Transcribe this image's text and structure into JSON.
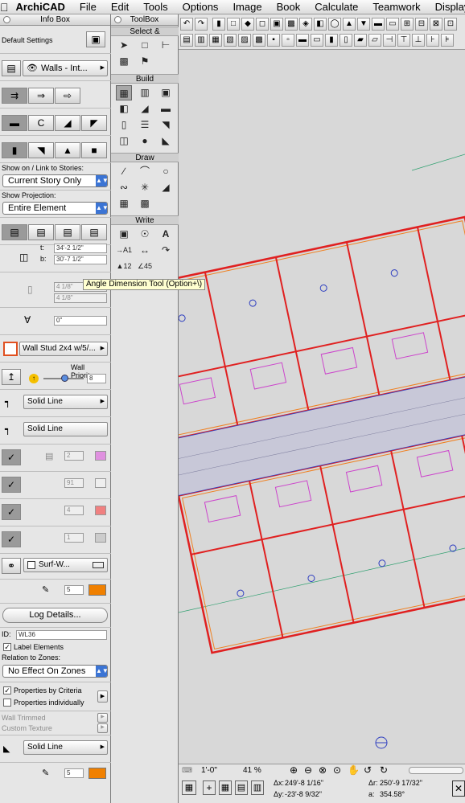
{
  "menubar": {
    "items": [
      "ArchiCAD",
      "File",
      "Edit",
      "Tools",
      "Options",
      "Image",
      "Book",
      "Calculate",
      "Teamwork",
      "Display"
    ]
  },
  "infobox": {
    "title": "Info Box",
    "default_settings": "Default Settings",
    "wall_type": "Walls - Int...",
    "show_on_label": "Show on / Link to Stories:",
    "show_on_value": "Current Story Only",
    "projection_label": "Show Projection:",
    "projection_value": "Entire Element",
    "t_label": "t:",
    "t_value": "34'-2 1/2\"",
    "b_label": "b:",
    "b_value": "30'-7 1/2\"",
    "thick1": "4 1/8\"",
    "thick2": "4 1/8\"",
    "angle_value": "0\"",
    "composite": "Wall Stud 2x4 w/5/...",
    "priority_label": "Wall Priority:",
    "priority_value": "8",
    "line1": "Solid Line",
    "line2": "Solid Line",
    "pen_a": "2",
    "pen_b": "91",
    "pen_c": "4",
    "pen_d": "1",
    "surface": "Surf-W...",
    "pen_e": "5",
    "log_details": "Log Details...",
    "id_label": "ID:",
    "id_value": "WL36",
    "label_elements": "Label Elements",
    "zones_label": "Relation to Zones:",
    "zones_value": "No Effect On Zones",
    "props_criteria": "Properties by Criteria",
    "props_individual": "Properties individually",
    "wall_trimmed": "Wall Trimmed",
    "custom_texture": "Custom Texture",
    "line3": "Solid Line",
    "pen_f": "5"
  },
  "toolbox": {
    "title": "ToolBox",
    "sections": [
      "Select &",
      "Build",
      "Draw",
      "Write"
    ]
  },
  "tooltip": "Angle Dimension Tool (Option+\\)",
  "statusbar": {
    "scale": "1'-0\"",
    "zoom": "41 %",
    "dx_label": "Δx:",
    "dx": "249'-8 1/16\"",
    "dy_label": "Δy:",
    "dy": "-23'-8 9/32\"",
    "dr_label": "Δr:",
    "dr": "250'-9 17/32\"",
    "a_label": "a:",
    "a": "354.58°"
  },
  "colors": {
    "accent": "#3b74d4",
    "wall_red": "#e02020",
    "wall_orange": "#f08020",
    "furniture_magenta": "#cc44cc",
    "symbol_blue": "#3040c0",
    "swatch_orange": "#f08000",
    "swatch_pink": "#e090e0",
    "swatch_red": "#f08080"
  }
}
